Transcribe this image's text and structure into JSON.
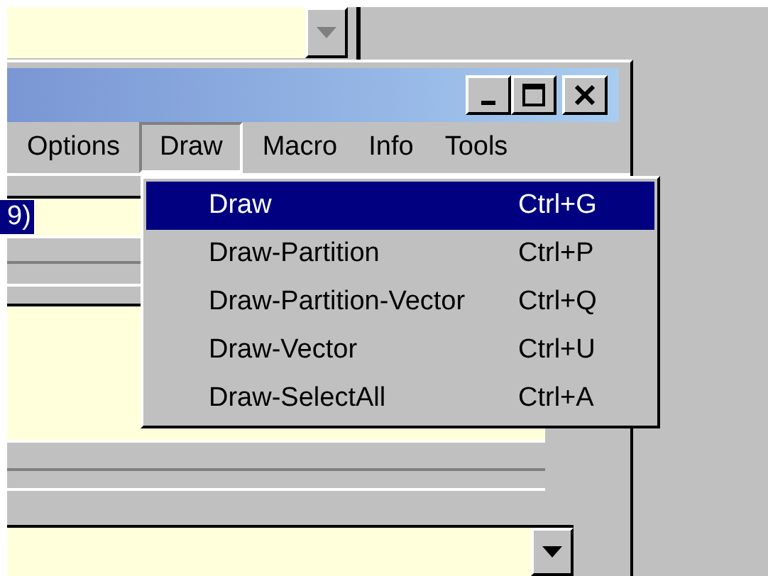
{
  "back_window": {
    "combo": {
      "disabled": true
    }
  },
  "window": {
    "title_buttons": [
      {
        "kind": "minimize"
      },
      {
        "kind": "maximize"
      },
      {
        "kind": "close"
      }
    ],
    "menu_bar": [
      {
        "label": "Options",
        "selected": false
      },
      {
        "label": "Draw",
        "selected": true
      },
      {
        "label": "Macro",
        "selected": false
      },
      {
        "label": "Info",
        "selected": false
      },
      {
        "label": "Tools",
        "selected": false
      }
    ],
    "field": {
      "value": "9)",
      "selected": true
    },
    "combo": {
      "disabled": false
    }
  },
  "dropdown_menu": [
    {
      "label": "Draw",
      "shortcut": "Ctrl+G",
      "selected": true
    },
    {
      "label": "Draw-Partition",
      "shortcut": "Ctrl+P",
      "selected": false
    },
    {
      "label": "Draw-Partition-Vector",
      "shortcut": "Ctrl+Q",
      "selected": false
    },
    {
      "label": "Draw-Vector",
      "shortcut": "Ctrl+U",
      "selected": false
    },
    {
      "label": "Draw-SelectAll",
      "shortcut": "Ctrl+A",
      "selected": false
    }
  ]
}
